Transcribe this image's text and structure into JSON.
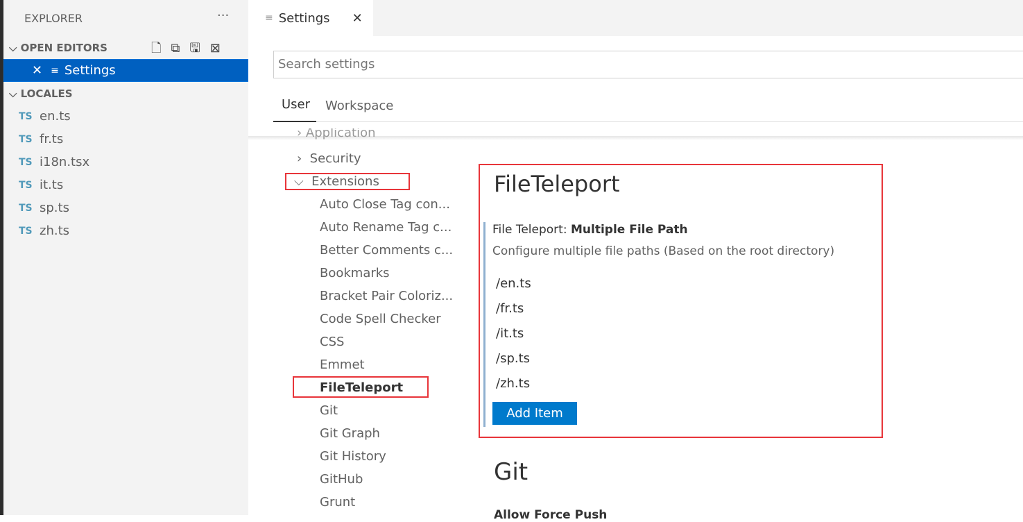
{
  "sidebar": {
    "title": "EXPLORER",
    "more": "···",
    "open_editors": "OPEN EDITORS",
    "open_item": "Settings",
    "locales": "LOCALES",
    "files": [
      "en.ts",
      "fr.ts",
      "i18n.tsx",
      "it.ts",
      "sp.ts",
      "zh.ts"
    ],
    "file_badge": "TS"
  },
  "tab": {
    "label": "Settings"
  },
  "search": {
    "placeholder": "Search settings"
  },
  "scope_tabs": [
    "User",
    "Workspace"
  ],
  "toc": {
    "partial": "Application",
    "security": "Security",
    "extensions": "Extensions",
    "items": [
      "Auto Close Tag con...",
      "Auto Rename Tag c...",
      "Better Comments c...",
      "Bookmarks",
      "Bracket Pair Coloriz...",
      "Code Spell Checker",
      "CSS",
      "Emmet",
      "FileTeleport",
      "Git",
      "Git Graph",
      "Git History",
      "GitHub",
      "Grunt"
    ]
  },
  "main": {
    "section": "FileTeleport",
    "setting_prefix": "File Teleport: ",
    "setting_name": "Multiple File Path",
    "description": "Configure multiple file paths (Based on the root directory)",
    "values": [
      "/en.ts",
      "/fr.ts",
      "/it.ts",
      "/sp.ts",
      "/zh.ts"
    ],
    "add_item": "Add Item",
    "next_section": "Git",
    "next_setting": "Allow Force Push"
  },
  "colors": {
    "accent": "#0060c0",
    "button": "#007acc",
    "highlight": "#e8353a"
  }
}
